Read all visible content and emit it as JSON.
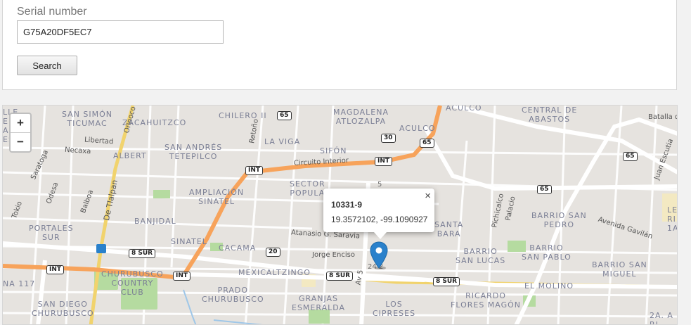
{
  "search": {
    "label": "Serial number",
    "value": "G75A20DF5EC7",
    "button": "Search"
  },
  "map": {
    "zoom_in": "+",
    "zoom_out": "−",
    "popup": {
      "title": "10331-9",
      "coords": "19.3572102, -99.1090927",
      "close": "×"
    },
    "neighborhoods": {
      "san_simon": "SAN SIMÓN\nTICUMAC",
      "zacahuitzco": "ZACAHUITZCO",
      "chilero": "CHILERO II",
      "magdalena": "MAGDALENA\nATLOZALPA",
      "aculco_top": "ACULCO",
      "central_abastos": "CENTRAL DE\nABASTOS",
      "albert": "ALBERT",
      "san_andres": "SAN ANDRÉS\nTETEPILCO",
      "la_viga": "LA VIGA",
      "sifon": "SIFÓN",
      "aculco": "ACULCO",
      "sector_popular": "SECTOR\nPOPULA",
      "ampliacion": "AMPLIACIÓN\nSINATEL",
      "portales": "PORTALES\nSUR",
      "banjidal": "BANJIDAL",
      "sinatel": "SINATEL",
      "cacama": "CACAMA",
      "santa_barbara": "SANTA\nBARA",
      "barrio_san_pedro": "BARRIO SAN\nPEDRO",
      "barrio_san_lucas": "BARRIO\nSAN LUCAS",
      "barrio_san_pablo": "BARRIO\nSAN PABLO",
      "barrio_san_miguel": "BARRIO SAN\nMIGUEL",
      "mexicaltzingo": "MEXICALTZINGO",
      "churubusco_cc": "CHURUBUSCO\nCOUNTRY\nCLUB",
      "prado": "PRADO\nCHURUBUSCO",
      "granjas": "GRANJAS\nESMERALDA",
      "los_cipreses": "LOS\nCIPRESES",
      "ricardo": "RICARDO\nFLORES MAGÓN",
      "el_molino": "EL MOLINO",
      "san_diego": "SAN DIEGO\nCHURUBUSCO",
      "left_top": "LLE\nENTO\nAL\nES",
      "na117": "NA 117",
      "right_le": "LE\nRI\n1A.",
      "right_2a": "2A. A\nRI",
      "pablo_frag": "24 2",
      "s5_frag": "5"
    },
    "streets": {
      "circuito": "Circuito Interior",
      "atanasio": "Atanasio G. Saravia",
      "jorge": "Jorge Enciso",
      "avenida_gavilan": "Avenida Gavilán",
      "libertad": "Libertad",
      "necaxa": "Necaxa",
      "saratoga": "Saratoga",
      "odesa": "Odesa",
      "balboa": "Balboa",
      "tokio": "Tokio",
      "orinoco": "Orinoco",
      "retono": "Retoño",
      "de_tlalpan": "De Tlalpan",
      "pichicalco": "Pichicalco",
      "palacio": "Palacio",
      "juan_escutia": "Juan Escutia",
      "batalla": "Batalla de",
      "av5": "Av 5"
    },
    "shields": {
      "s65a": "65",
      "s65b": "65",
      "s65c": "65",
      "s65d": "65",
      "s30": "30",
      "int1": "INT",
      "int2": "INT",
      "int3": "INT",
      "int4": "INT",
      "s20": "20",
      "sur1": "8 SUR",
      "sur2": "8 SUR",
      "sur3": "8 SUR"
    },
    "colors": {
      "background": "#e6e3df",
      "major_road": "#f7a35b",
      "secondary_road": "#f1d36d",
      "park": "#b5dba0",
      "marker": "#2a81cb"
    }
  }
}
